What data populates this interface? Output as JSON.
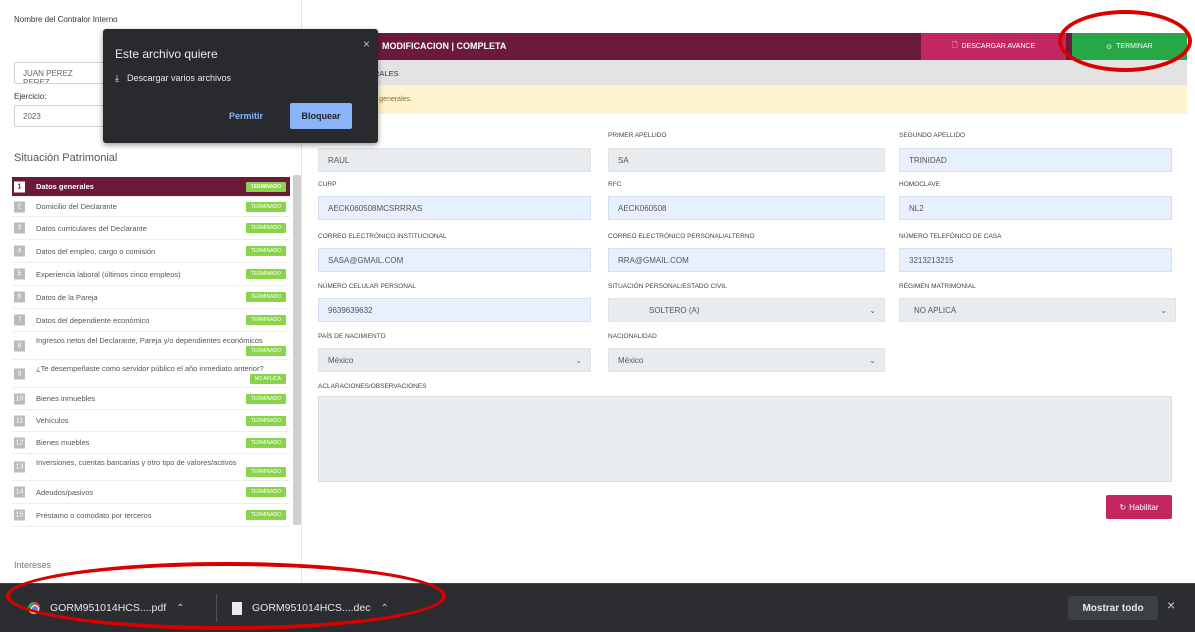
{
  "sidebar": {
    "contralor_label": "Nombre del Contralor Interno",
    "contralor_value": "JUAN PEREZ PEREZ",
    "ejercicio_label": "Ejercicio:",
    "ejercicio_value": "2023",
    "section_title": "Situación Patrimonial",
    "items": [
      {
        "num": "1",
        "label": "Datos generales",
        "badge": "TERMINADO"
      },
      {
        "num": "2",
        "label": "Domicilio del Declarante",
        "badge": "TERMINADO"
      },
      {
        "num": "3",
        "label": "Datos curriculares del Declarante",
        "badge": "TERMINADO"
      },
      {
        "num": "4",
        "label": "Datos del empleo, cargo o comisión",
        "badge": "TERMINADO"
      },
      {
        "num": "5",
        "label": "Experiencia laboral (últimos cinco empleos)",
        "badge": "TERMINADO"
      },
      {
        "num": "6",
        "label": "Datos de la Pareja",
        "badge": "TERMINADO"
      },
      {
        "num": "7",
        "label": "Datos del dependiente económico",
        "badge": "TERMINADO"
      },
      {
        "num": "8",
        "label": "Ingresos netos del Declarante, Pareja y/o dependientes económicos",
        "badge": "TERMINADO"
      },
      {
        "num": "9",
        "label": "¿Te desempeñaste como servidor público el año inmediato anterior?",
        "badge": "NO APLICA"
      },
      {
        "num": "10",
        "label": "Bienes inmuebles",
        "badge": "TERMINADO"
      },
      {
        "num": "11",
        "label": "Vehículos",
        "badge": "TERMINADO"
      },
      {
        "num": "12",
        "label": "Bienes muebles",
        "badge": "TERMINADO"
      },
      {
        "num": "13",
        "label": "Inversiones, cuentas bancarias y otro tipo de valores/activos",
        "badge": "TERMINADO"
      },
      {
        "num": "14",
        "label": "Adeudos/pasivos",
        "badge": "TERMINADO"
      },
      {
        "num": "15",
        "label": "Préstamo o comodato por terceros",
        "badge": "TERMINADO"
      }
    ],
    "bottom_section": "Intereses"
  },
  "header": {
    "title": "MODIFICACION | COMPLETA",
    "download_label": "DESCARGAR AVANCE",
    "finish_label": "TERMINAR",
    "subtitle": "RALES",
    "alert_text": "tos generales."
  },
  "form": {
    "primer_apellido_label": "PRIMER APELLIDO",
    "segundo_apellido_label": "SEGUNDO APELLIDO",
    "nombre_value": "RAUL",
    "primer_apellido_value": "SA",
    "segundo_apellido_value": "TRINIDAD",
    "curp_label": "CURP",
    "rfc_label": "RFC",
    "homoclave_label": "HOMOCLAVE",
    "curp_value": "AECK060508MCSRRRAS",
    "rfc_value": "AECK060508",
    "homoclave_value": "NL2",
    "correo_inst_label": "CORREO ELECTRÓNICO INSTITUCIONAL",
    "correo_pers_label": "CORREO ELECTRÓNICO PERSONAL/ALTERNO",
    "telefono_casa_label": "NÚMERO TELEFÓNICO DE CASA",
    "correo_inst_value": "SASA@GMAIL.COM",
    "correo_pers_value": "RRA@GMAIL.COM",
    "telefono_casa_value": "3213213215",
    "celular_label": "NÚMERO CELULAR PERSONAL",
    "estado_civil_label": "SITUACIÓN PERSONAL/ESTADO CIVIL",
    "regimen_label": "RÉGIMEN MATRIMONIAL",
    "celular_value": "9639639632",
    "estado_civil_value": "SOLTERO (A)",
    "regimen_value": "NO APLICA",
    "pais_label": "PAÍS DE NACIMIENTO",
    "nacionalidad_label": "NACIONALIDAD",
    "pais_value": "México",
    "nacionalidad_value": "México",
    "aclaraciones_label": "ACLARACIONES/OBSERVACIONES",
    "habilitar_label": "Habilitar"
  },
  "popup": {
    "title": "Este archivo quiere",
    "line": "Descargar varios archivos",
    "allow": "Permitir",
    "block": "Bloquear",
    "close": "×"
  },
  "downloads": {
    "items": [
      {
        "name": "GORM951014HCS....pdf",
        "icon": "chrome-icon"
      },
      {
        "name": "GORM951014HCS....dec",
        "icon": "document-icon"
      }
    ],
    "show_all": "Mostrar todo",
    "close": "×"
  },
  "colors": {
    "brand": "#6b1a3a",
    "accent_pink": "#c2275f",
    "success": "#27a745",
    "badge_green": "#8ad44a",
    "annotation_red": "#d90000"
  }
}
